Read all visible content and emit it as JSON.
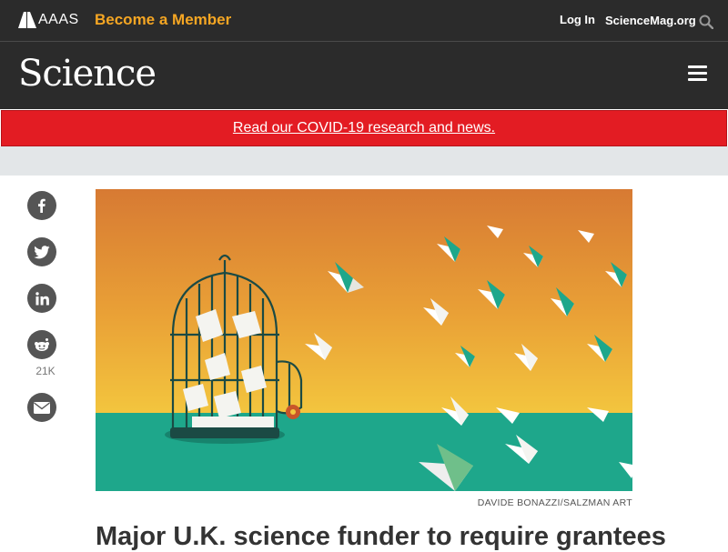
{
  "header": {
    "brand": "AAAS",
    "become_member": "Become a Member",
    "login": "Log In",
    "site_link": "ScienceMag.org"
  },
  "masthead": {
    "logo": "Science"
  },
  "alert": {
    "text": "Read our COVID-19 research and news."
  },
  "share": {
    "reddit_count": "21K",
    "icons": [
      "facebook-icon",
      "twitter-icon",
      "linkedin-icon",
      "reddit-icon",
      "email-icon"
    ]
  },
  "article": {
    "image_credit": "DAVIDE BONAZZI/SALZMAN ART",
    "headline": "Major U.K. science funder to require grantees"
  },
  "colors": {
    "dark_bar": "#2b2b2b",
    "accent_orange": "#f5a623",
    "alert_red": "#e31c23"
  }
}
